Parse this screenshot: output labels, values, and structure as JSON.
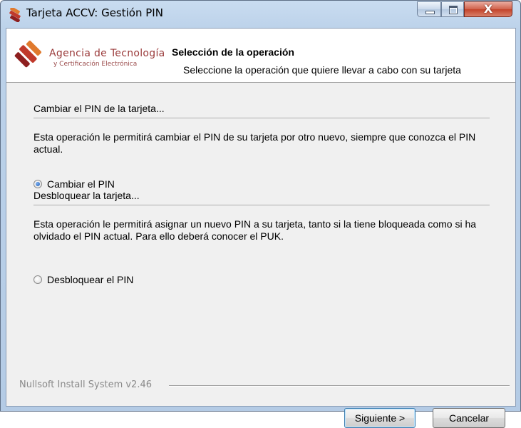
{
  "window": {
    "title": "Tarjeta ACCV: Gestión PIN",
    "close_glyph": "X"
  },
  "header": {
    "logo_line1": "Agencia de Tecnología",
    "logo_line2": "y Certificación Electrónica",
    "title": "Selección de la operación",
    "subtitle": "Seleccione la operación que quiere llevar a cabo con su tarjeta"
  },
  "sections": [
    {
      "heading": "Cambiar el PIN de la tarjeta...",
      "description": "Esta operación le permitirá cambiar el PIN de su tarjeta por otro nuevo, siempre que conozca el PIN actual.",
      "option_label": "Cambiar el PIN",
      "selected": true
    },
    {
      "heading": "Desbloquear la tarjeta...",
      "description": "Esta operación le permitirá asignar un nuevo PIN a su tarjeta, tanto si la tiene bloqueada como si ha olvidado el PIN actual. Para ello deberá conocer el PUK.",
      "option_label": "Desbloquear el PIN",
      "selected": false
    }
  ],
  "footer": {
    "branding": "Nullsoft Install System v2.46",
    "next_label": "Siguiente >",
    "cancel_label": "Cancelar"
  },
  "colors": {
    "title_bar": "#bcd2ea",
    "close_button": "#c3432a",
    "logo_red": "#c0392b",
    "dialog_body": "#f0f0f0",
    "default_button_border": "#3c7fb1"
  },
  "icons": {
    "app": "accv-logo-icon",
    "minimize": "minimize-icon",
    "maximize": "maximize-icon",
    "close": "close-icon",
    "logo": "accv-logo-icon"
  }
}
